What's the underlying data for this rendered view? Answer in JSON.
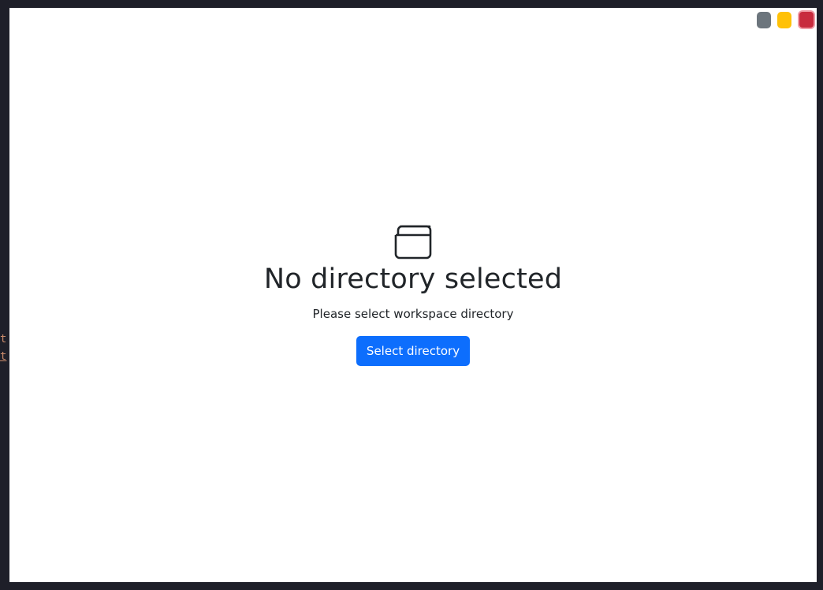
{
  "background_code": {
    "line1": "t",
    "line2": "t"
  },
  "window_controls": {
    "minimize_color": "#6c757d",
    "maximize_color": "#ffc107",
    "close_color": "#c82b3d"
  },
  "empty_state": {
    "icon": "folder-icon",
    "title": "No directory selected",
    "subtitle": "Please select workspace directory",
    "button_label": "Select directory",
    "button_color": "#0d6efd"
  }
}
